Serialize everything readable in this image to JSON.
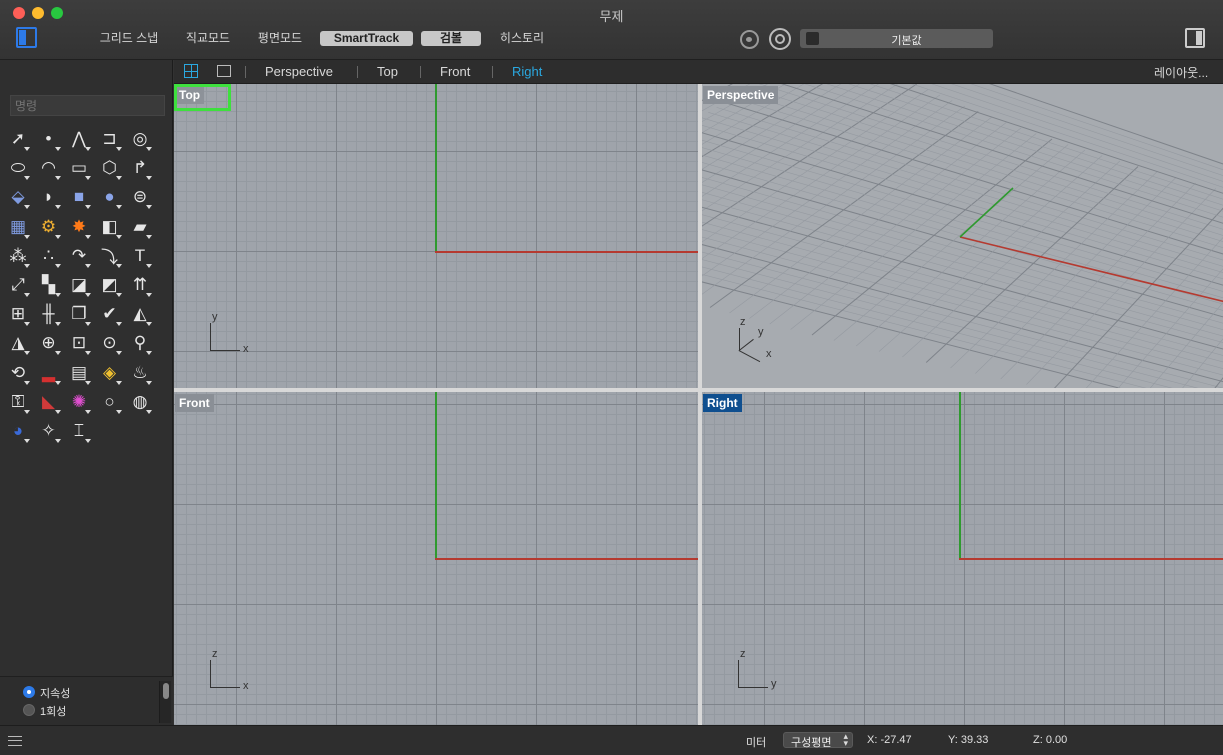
{
  "window": {
    "title": "무제"
  },
  "toolbar": {
    "buttons": [
      {
        "label": "그리드 스냅",
        "active": false
      },
      {
        "label": "직교모드",
        "active": false
      },
      {
        "label": "평면모드",
        "active": false
      },
      {
        "label": "SmartTrack",
        "active": true
      },
      {
        "label": "검볼",
        "active": true
      },
      {
        "label": "히스토리",
        "active": false
      }
    ],
    "display_mode": "기본값"
  },
  "viewport_tabs": {
    "tabs": [
      "Perspective",
      "Top",
      "Front",
      "Right"
    ],
    "active_tab": "Right",
    "layouts_label": "레이아웃..."
  },
  "command": {
    "placeholder": "명령"
  },
  "tool_icons": [
    "select-arrow-icon",
    "point-icon",
    "polyline-icon",
    "curve-icon",
    "circle-icon",
    "ellipse-icon",
    "arc-icon",
    "rectangle-icon",
    "polygon-icon",
    "fillet-curve-icon",
    "surface-from-points-icon",
    "extrude-surface-icon",
    "box-solid-icon",
    "sphere-solid-icon",
    "cylinder-solid-icon",
    "mesh-plane-icon",
    "gear-icon",
    "explode-icon",
    "boolean-icon",
    "solid-edit-icon",
    "join-circles-icon",
    "group-circles-icon",
    "rotate-icon",
    "curve-tangent-icon",
    "text-icon",
    "move-icon",
    "grid-array-icon",
    "trim-icon",
    "box-edit-icon",
    "dimension-icon",
    "array-icon",
    "split-icon",
    "copy-icon",
    "check-icon",
    "cut-plane-icon",
    "folder-icon",
    "zoom-extent-icon",
    "zoom-window-icon",
    "zoom-selected-icon",
    "zoom-in-icon",
    "rotate-view-icon",
    "car-icon",
    "grid-layer-icon",
    "shapes-layer-icon",
    "light-bulb-icon",
    "lock-icon",
    "book-icon",
    "color-wheel-icon",
    "white-circle-icon",
    "material-circle-icon",
    "render-sphere-icon",
    "spotlight-icon",
    "dimension-tool-icon"
  ],
  "osnap": {
    "options": [
      {
        "label": "지속성",
        "checked": true
      },
      {
        "label": "1회성",
        "checked": false
      }
    ]
  },
  "viewports": [
    {
      "name": "Top",
      "selected": true,
      "axes": [
        "y",
        "x"
      ]
    },
    {
      "name": "Perspective",
      "selected": false,
      "axes": [
        "z",
        "y",
        "x"
      ]
    },
    {
      "name": "Front",
      "selected": false,
      "axes": [
        "z",
        "x"
      ]
    },
    {
      "name": "Right",
      "selected": false,
      "axes": [
        "z",
        "y"
      ]
    }
  ],
  "status": {
    "units": "미터",
    "cplane": "구성평면",
    "x": "X: -27.47",
    "y": "Y: 39.33",
    "z": "Z: 0.00"
  },
  "colors": {
    "accent": "#2aa8e0",
    "selected_outline": "#3ee03e",
    "x_axis": "#b53a30",
    "y_axis": "#2f9a2f",
    "right_label_bg": "#0f4f8f"
  }
}
